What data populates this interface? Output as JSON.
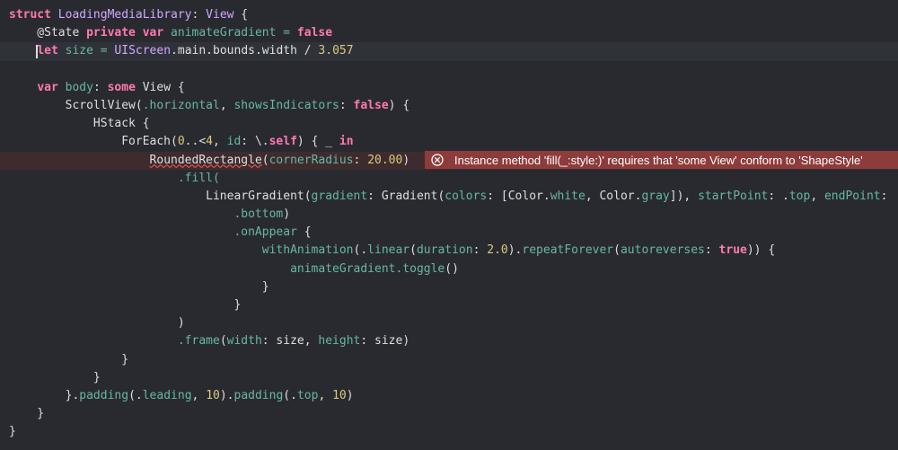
{
  "editor": {
    "lines": [
      [
        {
          "t": "struct ",
          "c": "kw"
        },
        {
          "t": "LoadingMediaLibrary",
          "c": "ty"
        },
        {
          "t": ": ",
          "c": "pl"
        },
        {
          "t": "View",
          "c": "ty"
        },
        {
          "t": " {",
          "c": "pl"
        }
      ],
      [
        {
          "t": "    @State ",
          "c": "pl"
        },
        {
          "t": "private",
          "c": "kw"
        },
        {
          "t": " ",
          "c": "pl"
        },
        {
          "t": "var",
          "c": "kw"
        },
        {
          "t": " animateGradient = ",
          "c": "pr"
        },
        {
          "t": "false",
          "c": "kw"
        }
      ],
      [
        {
          "t": "    ",
          "c": "pl"
        },
        {
          "t": "let",
          "c": "kw"
        },
        {
          "t": " size = ",
          "c": "pr"
        },
        {
          "t": "UIScreen",
          "c": "ty"
        },
        {
          "t": ".main.bounds.width / ",
          "c": "pl"
        },
        {
          "t": "3.057",
          "c": "nm"
        }
      ],
      [],
      [
        {
          "t": "    ",
          "c": "pl"
        },
        {
          "t": "var",
          "c": "kw"
        },
        {
          "t": " body",
          "c": "pr"
        },
        {
          "t": ": ",
          "c": "pl"
        },
        {
          "t": "some",
          "c": "kw"
        },
        {
          "t": " View {",
          "c": "pl"
        }
      ],
      [
        {
          "t": "        ScrollView(",
          "c": "pl"
        },
        {
          "t": ".horizontal",
          "c": "pr"
        },
        {
          "t": ", ",
          "c": "pl"
        },
        {
          "t": "showsIndicators",
          "c": "pr"
        },
        {
          "t": ": ",
          "c": "pl"
        },
        {
          "t": "false",
          "c": "kw"
        },
        {
          "t": ") {",
          "c": "pl"
        }
      ],
      [
        {
          "t": "            HStack {",
          "c": "pl"
        }
      ],
      [
        {
          "t": "                ForEach(",
          "c": "pl"
        },
        {
          "t": "0",
          "c": "nm"
        },
        {
          "t": "..<",
          "c": "pl"
        },
        {
          "t": "4",
          "c": "nm"
        },
        {
          "t": ", ",
          "c": "pl"
        },
        {
          "t": "id",
          "c": "pr"
        },
        {
          "t": ": \\.",
          "c": "pl"
        },
        {
          "t": "self",
          "c": "kw"
        },
        {
          "t": ") { _ ",
          "c": "pl"
        },
        {
          "t": "in",
          "c": "kw"
        }
      ],
      [
        {
          "t": "                    ",
          "c": "pl"
        },
        {
          "t": "RoundedRectangle",
          "c": "pl",
          "u": true
        },
        {
          "t": "(",
          "c": "pl"
        },
        {
          "t": "cornerRadius",
          "c": "pr"
        },
        {
          "t": ": ",
          "c": "pl"
        },
        {
          "t": "20.00",
          "c": "nm"
        },
        {
          "t": ")",
          "c": "pl"
        }
      ],
      [
        {
          "t": "                        .fill(",
          "c": "pr"
        }
      ],
      [
        {
          "t": "                            LinearGradient(",
          "c": "pl"
        },
        {
          "t": "gradient",
          "c": "pr"
        },
        {
          "t": ": Gradient(",
          "c": "pl"
        },
        {
          "t": "colors",
          "c": "pr"
        },
        {
          "t": ": [Color.",
          "c": "pl"
        },
        {
          "t": "white",
          "c": "pr"
        },
        {
          "t": ", Color.",
          "c": "pl"
        },
        {
          "t": "gray",
          "c": "pr"
        },
        {
          "t": "]), ",
          "c": "pl"
        },
        {
          "t": "startPoint",
          "c": "pr"
        },
        {
          "t": ": .",
          "c": "pl"
        },
        {
          "t": "top",
          "c": "pr"
        },
        {
          "t": ", ",
          "c": "pl"
        },
        {
          "t": "endPoint",
          "c": "pr"
        },
        {
          "t": ":",
          "c": "pl"
        }
      ],
      [
        {
          "t": "                                .bottom",
          "c": "pr"
        },
        {
          "t": ")",
          "c": "pl"
        }
      ],
      [
        {
          "t": "                                .onAppear",
          "c": "pr"
        },
        {
          "t": " {",
          "c": "pl"
        }
      ],
      [
        {
          "t": "                                    withAnimation",
          "c": "pr"
        },
        {
          "t": "(.",
          "c": "pl"
        },
        {
          "t": "linear",
          "c": "pr"
        },
        {
          "t": "(",
          "c": "pl"
        },
        {
          "t": "duration",
          "c": "pr"
        },
        {
          "t": ": ",
          "c": "pl"
        },
        {
          "t": "2.0",
          "c": "nm"
        },
        {
          "t": ").",
          "c": "pl"
        },
        {
          "t": "repeatForever",
          "c": "pr"
        },
        {
          "t": "(",
          "c": "pl"
        },
        {
          "t": "autoreverses",
          "c": "pr"
        },
        {
          "t": ": ",
          "c": "pl"
        },
        {
          "t": "true",
          "c": "kw"
        },
        {
          "t": ")) {",
          "c": "pl"
        }
      ],
      [
        {
          "t": "                                        animateGradient.toggle",
          "c": "pr"
        },
        {
          "t": "()",
          "c": "pl"
        }
      ],
      [
        {
          "t": "                                    }",
          "c": "pl"
        }
      ],
      [
        {
          "t": "                                }",
          "c": "pl"
        }
      ],
      [
        {
          "t": "                        )",
          "c": "pl"
        }
      ],
      [
        {
          "t": "                        .frame",
          "c": "pr"
        },
        {
          "t": "(",
          "c": "pl"
        },
        {
          "t": "width",
          "c": "pr"
        },
        {
          "t": ": size, ",
          "c": "pl"
        },
        {
          "t": "height",
          "c": "pr"
        },
        {
          "t": ": size)",
          "c": "pl"
        }
      ],
      [
        {
          "t": "                }",
          "c": "pl"
        }
      ],
      [
        {
          "t": "            }",
          "c": "pl"
        }
      ],
      [
        {
          "t": "        }.",
          "c": "pl"
        },
        {
          "t": "padding",
          "c": "pr"
        },
        {
          "t": "(.",
          "c": "pl"
        },
        {
          "t": "leading",
          "c": "pr"
        },
        {
          "t": ", ",
          "c": "pl"
        },
        {
          "t": "10",
          "c": "nm"
        },
        {
          "t": ").",
          "c": "pl"
        },
        {
          "t": "padding",
          "c": "pr"
        },
        {
          "t": "(.",
          "c": "pl"
        },
        {
          "t": "top",
          "c": "pr"
        },
        {
          "t": ", ",
          "c": "pl"
        },
        {
          "t": "10",
          "c": "nm"
        },
        {
          "t": ")",
          "c": "pl"
        }
      ],
      [
        {
          "t": "    }",
          "c": "pl"
        }
      ],
      [
        {
          "t": "}",
          "c": "pl"
        }
      ]
    ],
    "current_line_index": 2,
    "error_line_index": 8
  },
  "error": {
    "icon": "error-circle-x-icon",
    "message": "Instance method 'fill(_:style:)' requires that 'some View' conform to 'ShapeStyle'"
  },
  "colors": {
    "background": "#292a30",
    "keyword": "#ff7ab2",
    "type": "#d0a8ff",
    "property": "#67b7a4",
    "number": "#d9c97c",
    "plain": "#dfdfe0",
    "error_banner": "#8e3b3b"
  }
}
